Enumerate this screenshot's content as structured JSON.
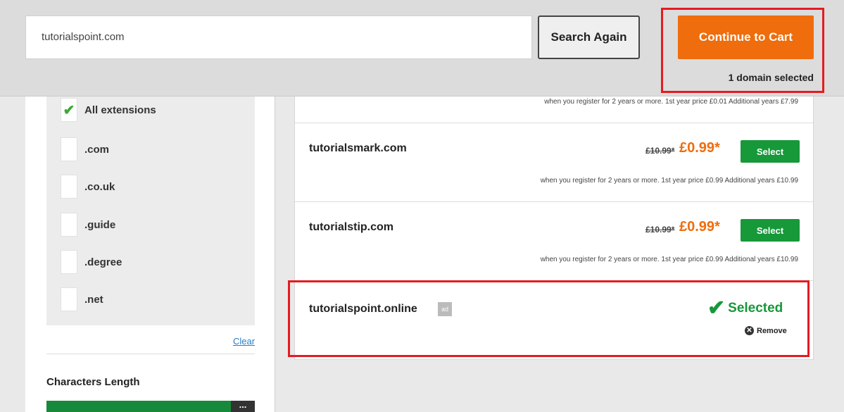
{
  "search": {
    "query": "tutorialspoint.com",
    "search_again_label": "Search Again"
  },
  "cart": {
    "continue_label": "Continue to Cart",
    "selected_count": "1 domain selected"
  },
  "filters": {
    "extensions": [
      {
        "label": "All extensions",
        "checked": true
      },
      {
        "label": ".com",
        "checked": false
      },
      {
        "label": ".co.uk",
        "checked": false
      },
      {
        "label": ".guide",
        "checked": false
      },
      {
        "label": ".degree",
        "checked": false
      },
      {
        "label": ".net",
        "checked": false
      }
    ],
    "clear_label": "Clear",
    "characters_length_title": "Characters Length",
    "menu_glyph": "..."
  },
  "results": {
    "truncated_note": "when you register for 2 years or more. 1st year price £0.01 Additional years £7.99",
    "rows": [
      {
        "domain": "tutorialsmark.com",
        "old_price": "£10.99*",
        "new_price": "£0.99*",
        "select_label": "Select",
        "note": "when you register for 2 years or more. 1st year price £0.99 Additional years £10.99"
      },
      {
        "domain": "tutorialstip.com",
        "old_price": "£10.99*",
        "new_price": "£0.99*",
        "select_label": "Select",
        "note": "when you register for 2 years or more. 1st year price £0.99 Additional years £10.99"
      }
    ],
    "selected_row": {
      "domain": "tutorialspoint.online",
      "ad_badge": "ad",
      "selected_label": "Selected",
      "remove_label": "Remove"
    }
  },
  "colors": {
    "accent_orange": "#ef6d0c",
    "select_green": "#179839",
    "highlight_red": "#e41b23"
  }
}
